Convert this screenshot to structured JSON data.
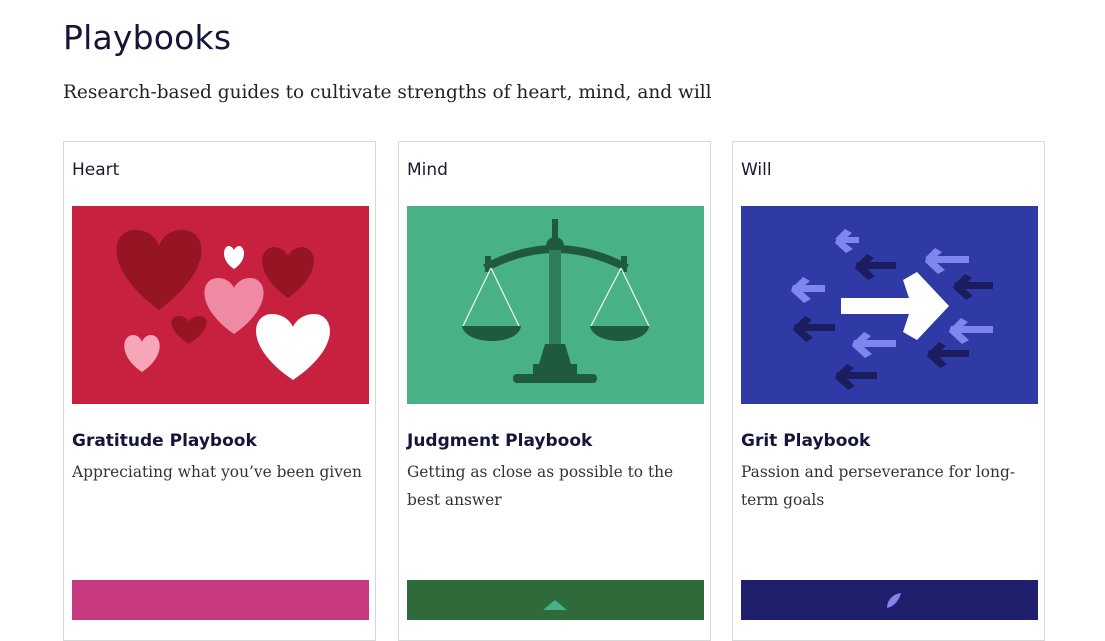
{
  "page": {
    "title": "Playbooks",
    "subtitle": "Research-based guides to cultivate strengths of heart, mind, and will"
  },
  "cards": [
    {
      "category": "Heart",
      "title": "Gratitude Playbook",
      "description": "Appreciating what you’ve been given",
      "image_icon": "hearts-illustration",
      "image_bg": "#c8203f",
      "next_image_bg": "#c83a7f"
    },
    {
      "category": "Mind",
      "title": "Judgment Playbook",
      "description": "Getting as close as possible to the best answer",
      "image_icon": "balance-scale-illustration",
      "image_bg": "#49b186",
      "next_image_bg": "#2e6a3a"
    },
    {
      "category": "Will",
      "title": "Grit Playbook",
      "description": "Passion and perseverance for long-term goals",
      "image_icon": "arrows-illustration",
      "image_bg": "#2f3aa6",
      "next_image_bg": "#1f1f6e"
    }
  ]
}
